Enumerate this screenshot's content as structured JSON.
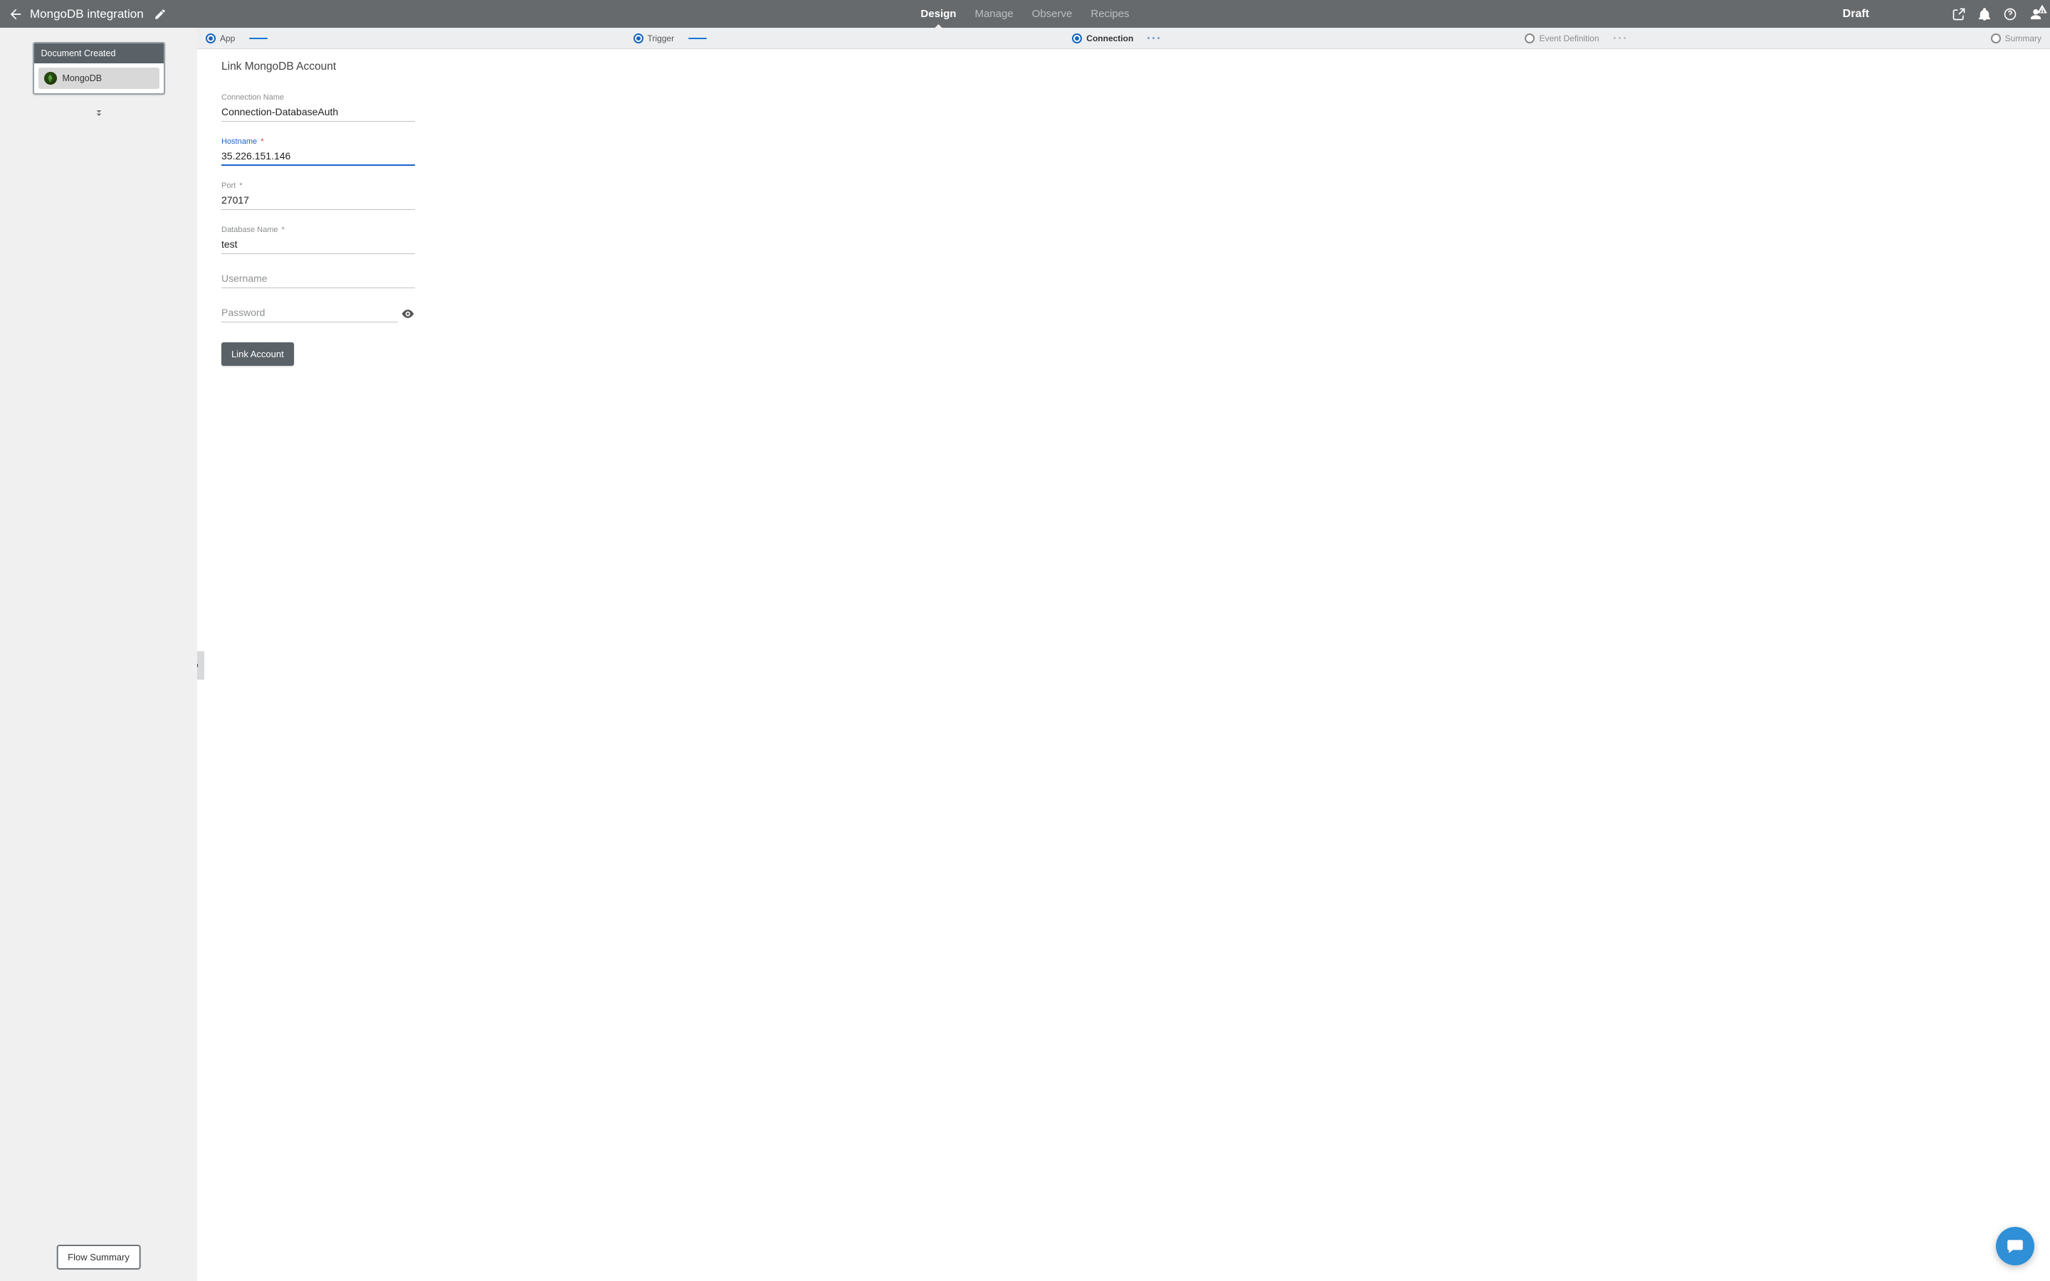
{
  "header": {
    "title": "MongoDB integration",
    "tabs": {
      "design": "Design",
      "manage": "Manage",
      "observe": "Observe",
      "recipes": "Recipes"
    },
    "status": "Draft"
  },
  "stepper": {
    "app": "App",
    "trigger": "Trigger",
    "connection": "Connection",
    "event_definition": "Event Definition",
    "summary": "Summary"
  },
  "sidebar": {
    "card_title": "Document Created",
    "item_label": "MongoDB",
    "flow_summary": "Flow Summary"
  },
  "page": {
    "title": "Link MongoDB Account"
  },
  "form": {
    "connection_name": {
      "label": "Connection Name",
      "value": "Connection-DatabaseAuth"
    },
    "hostname": {
      "label": "Hostname",
      "value": "35.226.151.146",
      "required": "*"
    },
    "port": {
      "label": "Port",
      "value": "27017",
      "required": "*"
    },
    "database_name": {
      "label": "Database Name",
      "value": "test",
      "required": "*"
    },
    "username": {
      "label": "Username",
      "value": ""
    },
    "password": {
      "label": "Password",
      "value": ""
    },
    "submit": "Link Account"
  }
}
